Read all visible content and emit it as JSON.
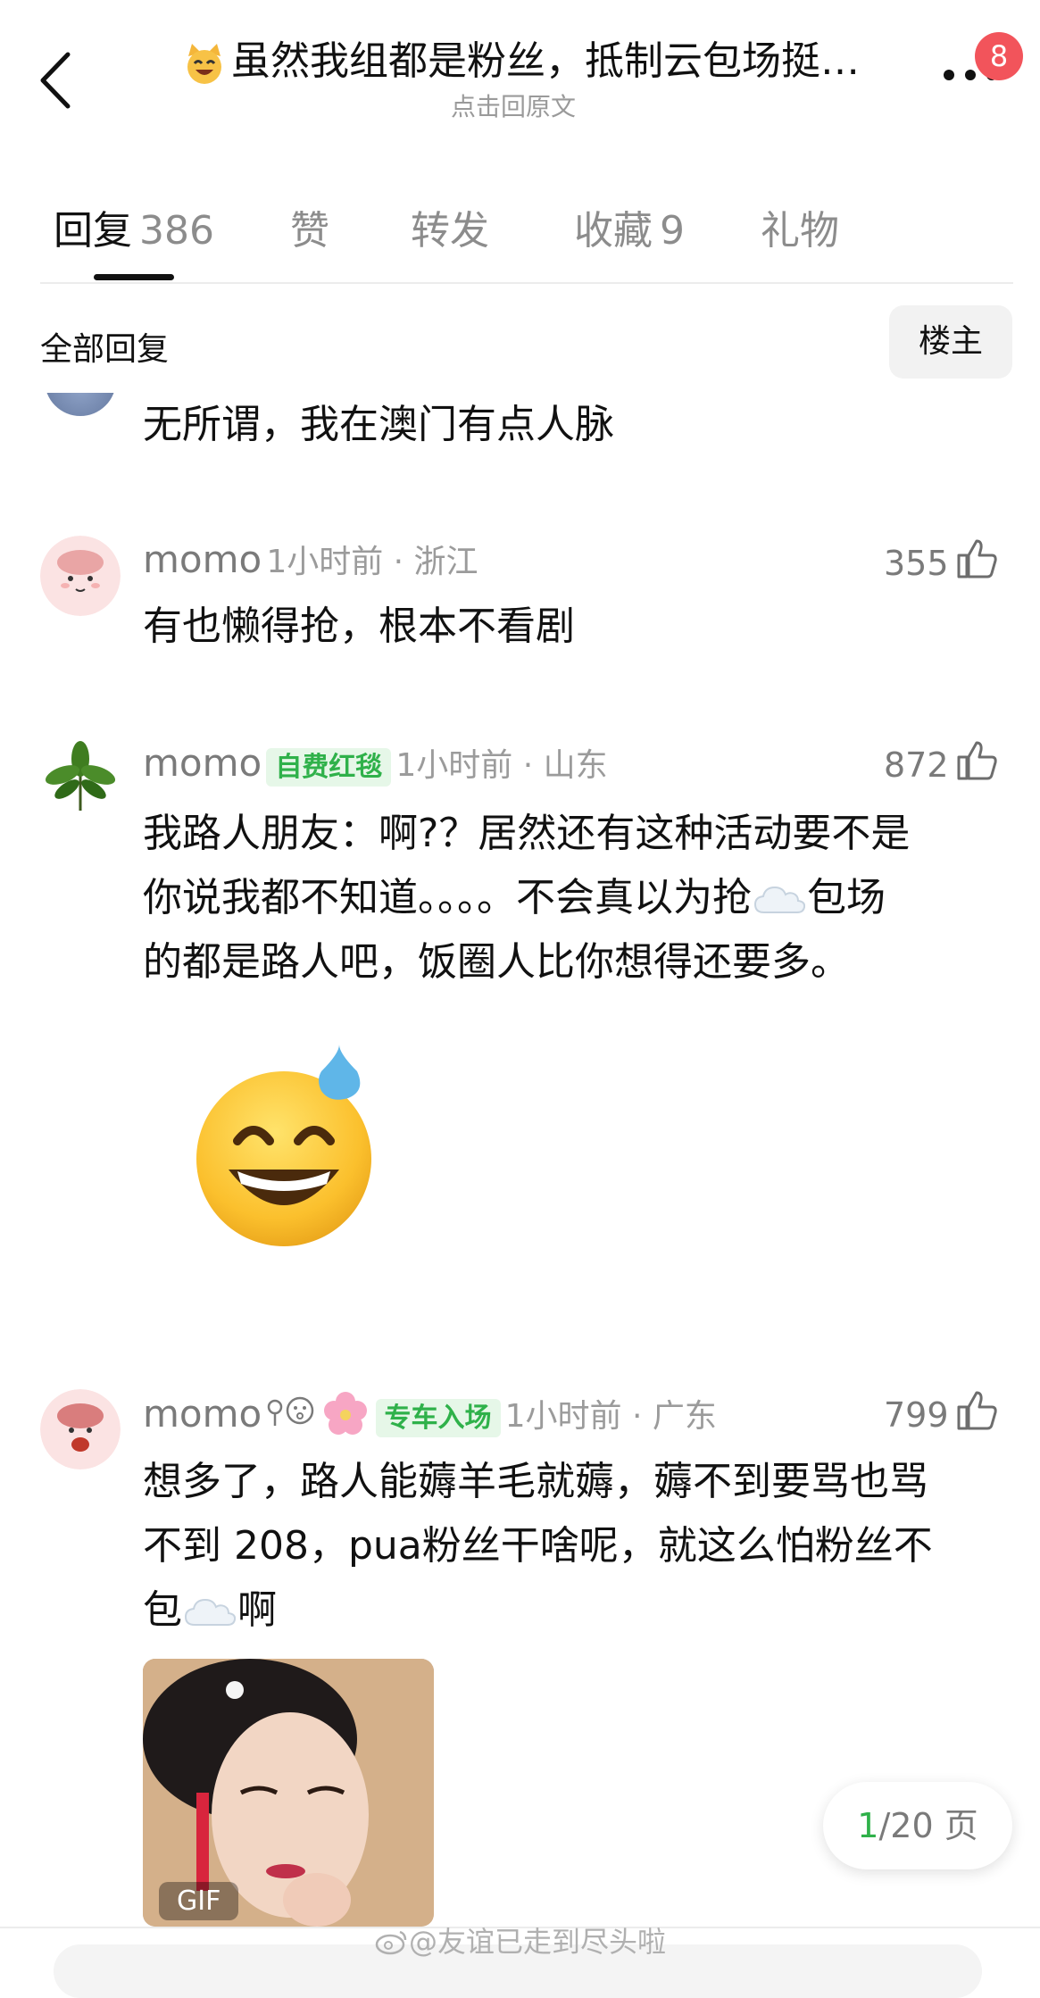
{
  "header": {
    "title": "虽然我组都是粉丝，抵制云包场挺…",
    "subtitle": "点击回原文",
    "notification_count": "8"
  },
  "tabs": [
    {
      "label": "回复",
      "count": "386"
    },
    {
      "label": "赞",
      "count": ""
    },
    {
      "label": "转发",
      "count": ""
    },
    {
      "label": "收藏",
      "count": "9"
    },
    {
      "label": "礼物",
      "count": ""
    }
  ],
  "filter": {
    "all_replies_label": "全部回复",
    "op_button_label": "楼主"
  },
  "comments": [
    {
      "text": "无所谓，我在澳门有点人脉"
    },
    {
      "username": "momo",
      "time_location": "1小时前 · 浙江",
      "likes": "355",
      "text": "有也懒得抢，根本不看剧"
    },
    {
      "username": "momo",
      "badge": "自费红毯",
      "time_location": "1小时前 · 山东",
      "likes": "872",
      "lines": [
        "我路人朋友：啊?？居然还有这种活动要不是",
        "你说我都不知道。。。。不会真以为抢",
        "包场",
        "的都是路人吧，饭圈人比你想得还要多。"
      ]
    },
    {
      "username": "momo",
      "badge": "专车入场",
      "time_location": "1小时前 · 广东",
      "likes": "799",
      "lines": [
        "想多了，路人能薅羊毛就薅，薅不到要骂也骂",
        "不到 208，pua粉丝干啥呢，就这么怕粉丝不",
        "包",
        "啊"
      ],
      "media_label": "GIF"
    }
  ],
  "pager": {
    "current": "1",
    "total": "/20 页"
  },
  "watermark": "@友谊已走到尽头啦",
  "icons": {
    "back": "chevron-left-icon",
    "more": "more-dots-icon",
    "like": "thumbs-up-icon",
    "cloud": "cloud-emoji-icon",
    "emoji": "sweat-smile-emoji-icon"
  },
  "colors": {
    "accent_green": "#2fb14a",
    "badge_red": "#f2545b"
  }
}
